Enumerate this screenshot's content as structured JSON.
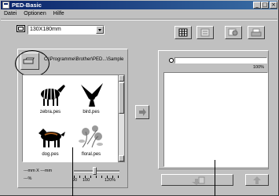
{
  "window": {
    "title": "PED-Basic"
  },
  "title_buttons": {
    "minimize": "_",
    "maximize": "□",
    "close": "×"
  },
  "menu": [
    "Datei",
    "Optionen",
    "Hilfe"
  ],
  "hoop_select": {
    "value": "130X180mm"
  },
  "path": "C:\\Programme\\Brother\\PED...\\Sample",
  "files": [
    {
      "name": "zebra.pes",
      "icon": "zebra-icon"
    },
    {
      "name": "bird.pes",
      "icon": "bird-icon"
    },
    {
      "name": "dog.pes",
      "icon": "dog-icon"
    },
    {
      "name": "floral.pes",
      "icon": "floral-icon"
    }
  ],
  "size_info": {
    "line1": "---mm X ---mm",
    "line2": "---%"
  },
  "zoom_slider": {
    "ticks": [
      "90",
      "100",
      "120%"
    ],
    "value_percent": 100
  },
  "transfer": {
    "percent_label": "100%",
    "progress": 1.0
  },
  "colors": {
    "titlebar_start": "#0a246a",
    "titlebar_end": "#3a6ea5",
    "face": "#c0c0c0"
  }
}
